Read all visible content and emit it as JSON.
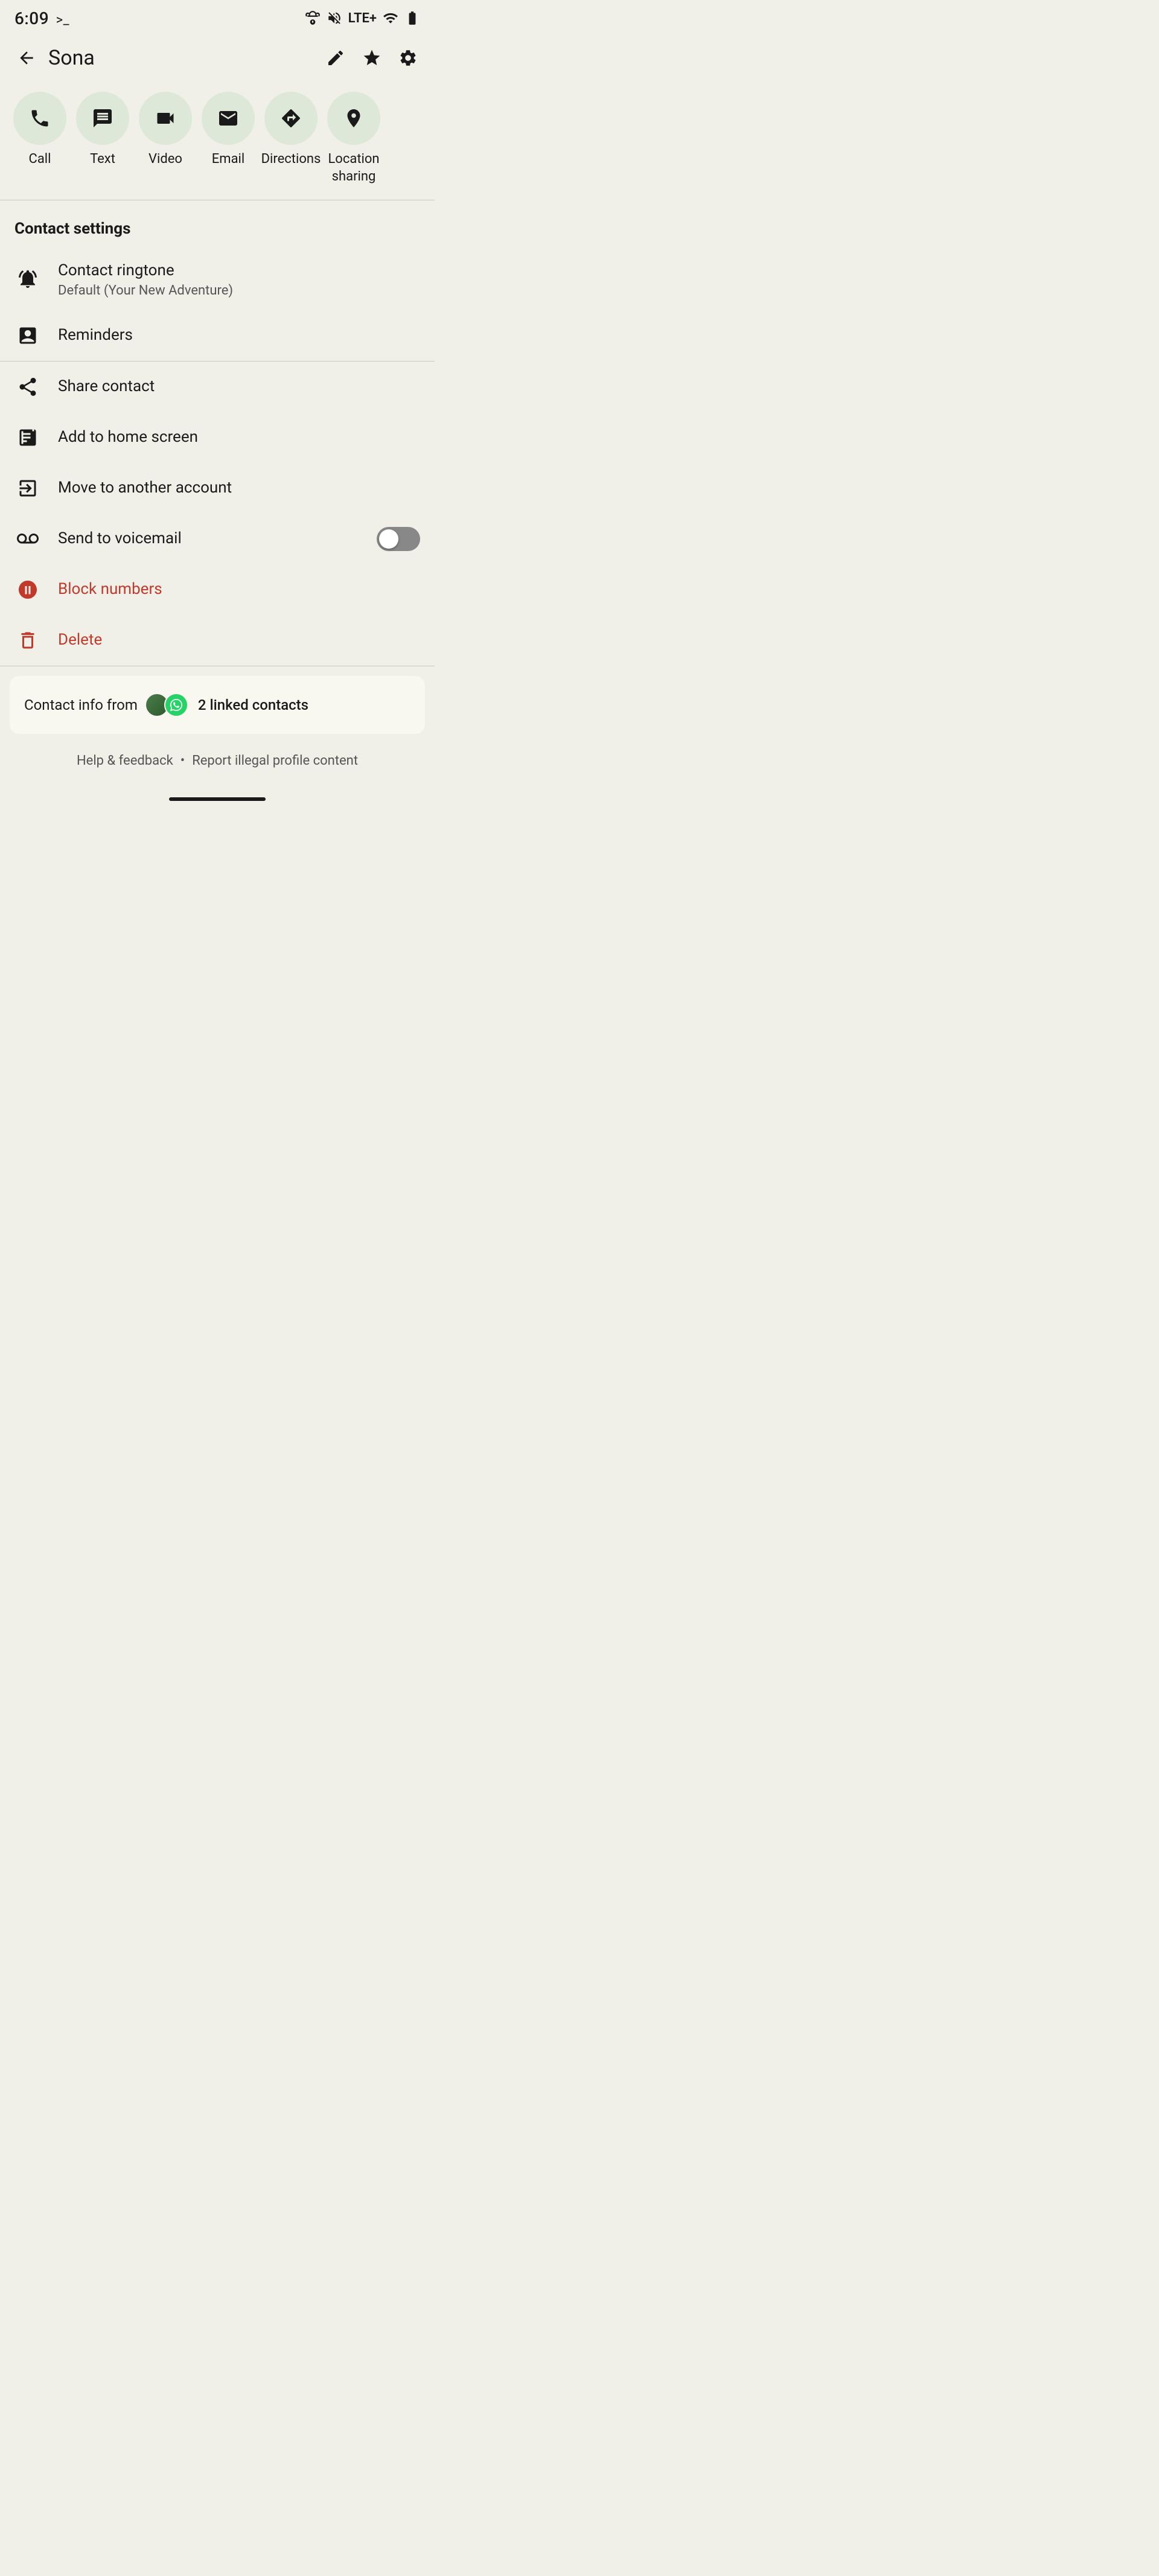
{
  "statusBar": {
    "time": "6:09",
    "prompt": ">_",
    "alarm": "⏰",
    "mute": "🔇",
    "network": "LTE+",
    "signal": "signal",
    "battery": "battery"
  },
  "header": {
    "back_label": "←",
    "contact_name": "Sona",
    "edit_icon": "edit",
    "star_icon": "star",
    "settings_icon": "settings"
  },
  "actions": [
    {
      "id": "call",
      "label": "Call",
      "icon": "phone"
    },
    {
      "id": "text",
      "label": "Text",
      "icon": "message"
    },
    {
      "id": "video",
      "label": "Video",
      "icon": "video"
    },
    {
      "id": "email",
      "label": "Email",
      "icon": "email"
    },
    {
      "id": "directions",
      "label": "Directions",
      "icon": "directions"
    },
    {
      "id": "location",
      "label": "Location\nsharing",
      "icon": "location"
    }
  ],
  "contactSettings": {
    "header": "Contact settings",
    "items": [
      {
        "id": "ringtone",
        "label": "Contact ringtone",
        "sublabel": "Default (Your New Adventure)",
        "icon": "ringtone",
        "type": "navigate"
      },
      {
        "id": "reminders",
        "label": "Reminders",
        "icon": "reminders",
        "type": "navigate"
      }
    ]
  },
  "moreOptions": {
    "items": [
      {
        "id": "share",
        "label": "Share contact",
        "icon": "share",
        "type": "navigate",
        "color": "normal"
      },
      {
        "id": "homescreen",
        "label": "Add to home screen",
        "icon": "homescreen",
        "type": "navigate",
        "color": "normal"
      },
      {
        "id": "move",
        "label": "Move to another account",
        "icon": "move",
        "type": "navigate",
        "color": "normal"
      },
      {
        "id": "voicemail",
        "label": "Send to voicemail",
        "icon": "voicemail",
        "type": "toggle",
        "color": "normal",
        "toggled": false
      },
      {
        "id": "block",
        "label": "Block numbers",
        "icon": "block",
        "type": "navigate",
        "color": "red"
      },
      {
        "id": "delete",
        "label": "Delete",
        "icon": "delete",
        "type": "navigate",
        "color": "red"
      }
    ]
  },
  "footer": {
    "linked_info": "Contact info from",
    "linked_count": "2 linked contacts",
    "help_label": "Help & feedback",
    "dot": "•",
    "report_label": "Report illegal profile content"
  }
}
